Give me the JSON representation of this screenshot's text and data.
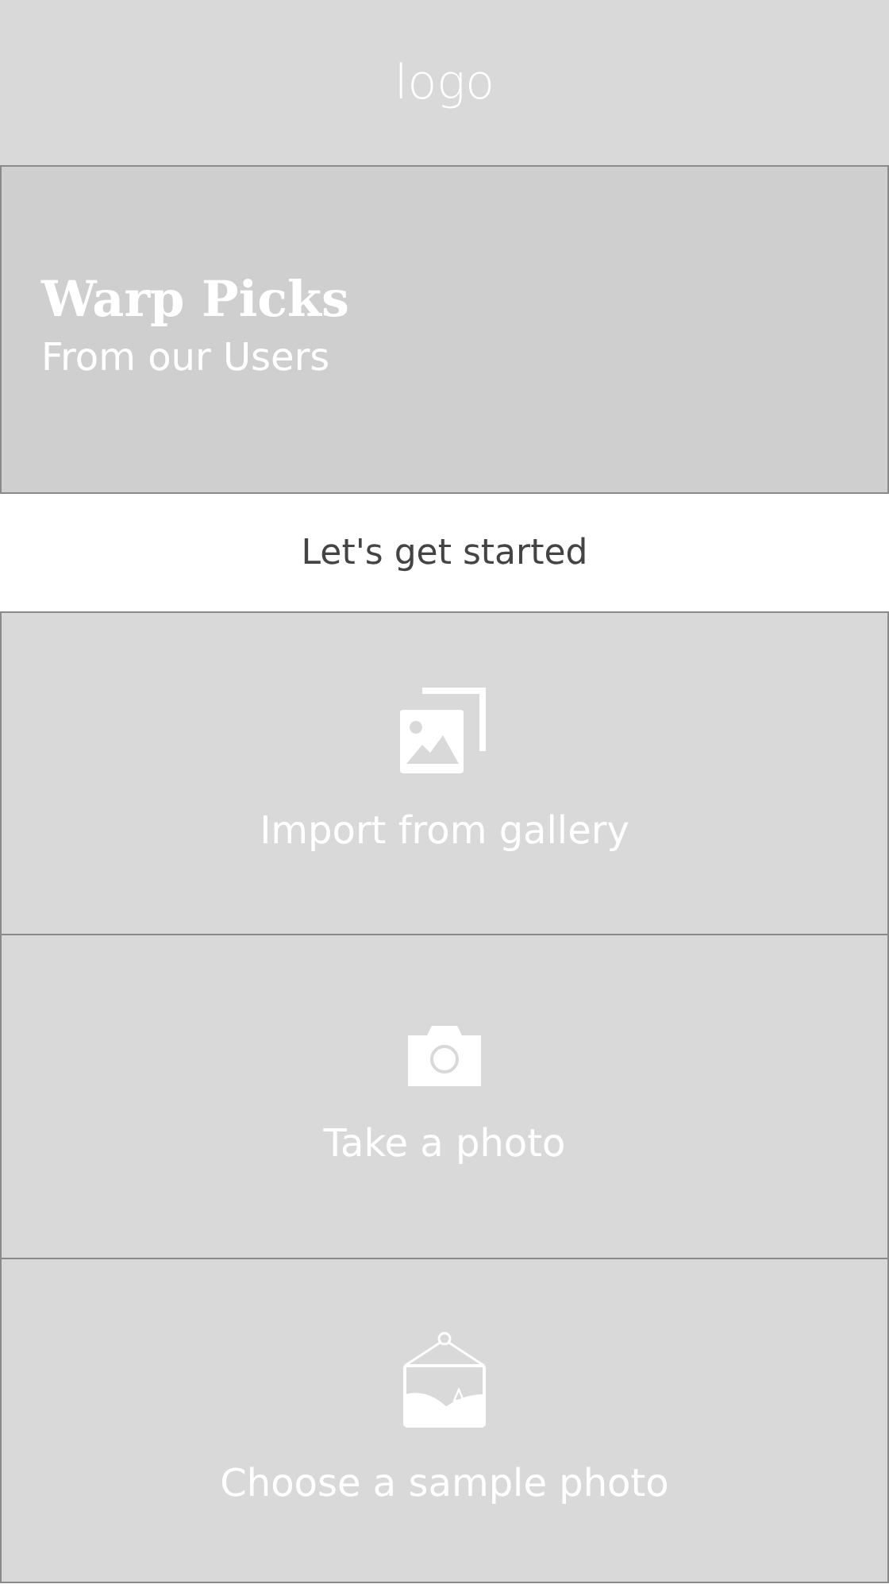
{
  "header": {
    "logo": "logo"
  },
  "banner": {
    "title": "Warp Picks",
    "subtitle": "From our Users"
  },
  "intro": "Let's get started",
  "options": [
    {
      "kind": "gallery",
      "label": "Import from gallery"
    },
    {
      "kind": "camera",
      "label": "Take a photo"
    },
    {
      "kind": "sample",
      "label": "Choose a sample photo"
    }
  ]
}
